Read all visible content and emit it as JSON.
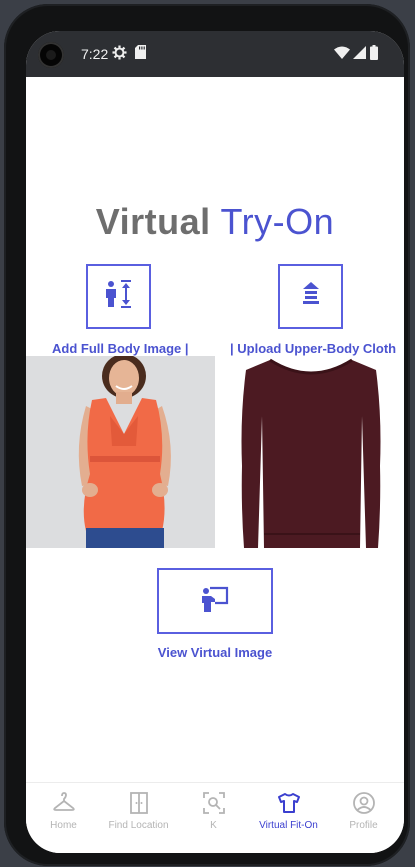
{
  "status_bar": {
    "time": "7:22",
    "icons": [
      "settings-icon",
      "sd-card-icon",
      "wifi-icon",
      "signal-icon",
      "battery-icon"
    ]
  },
  "title": {
    "part1": "Virtual",
    "part2": "Try-On",
    "color_part1": "#6e6e6e",
    "color_part2": "#4b53d0"
  },
  "actions": {
    "add_body": {
      "label": "Add Full Body Image |",
      "icon": "body-height-icon"
    },
    "upload_cloth": {
      "label": "| Upload Upper-Body Cloth",
      "icon": "upload-icon"
    },
    "view_virtual": {
      "label": "View Virtual Image",
      "icon": "presentation-icon"
    }
  },
  "images": {
    "body": "woman-in-orange-top-photo",
    "cloth": "maroon-long-sleeve-top-photo"
  },
  "bottom_nav": {
    "items": [
      {
        "label": "Home",
        "icon": "hanger-icon",
        "active": false
      },
      {
        "label": "Find Location",
        "icon": "door-icon",
        "active": false
      },
      {
        "label": "K",
        "icon": "scan-search-icon",
        "active": false
      },
      {
        "label": "Virtual Fit-On",
        "icon": "tshirt-icon",
        "active": true
      },
      {
        "label": "Profile",
        "icon": "account-icon",
        "active": false
      }
    ]
  },
  "colors": {
    "accent": "#4b53d0",
    "status_bar": "#2d2f33",
    "inactive_nav": "#b4b4b4"
  }
}
